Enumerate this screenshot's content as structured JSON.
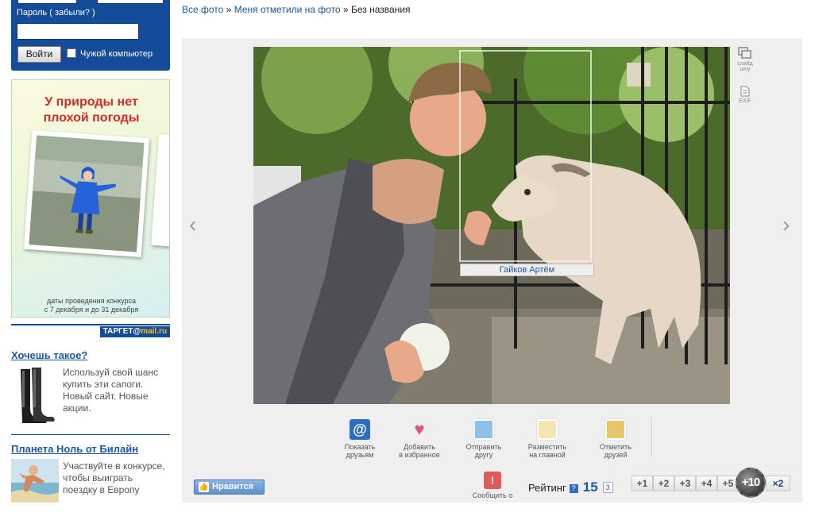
{
  "login": {
    "password_label": "Пароль",
    "forgot_link": "( забыли? )",
    "submit_label": "Войти",
    "foreign_computer_label": "Чужой компьютер"
  },
  "ad_banner": {
    "headline": "У природы нет плохой погоды",
    "dates_line1": "даты проведения конкурса",
    "dates_line2": "с 7 декабря и до 31 декабря",
    "source_label_prefix": "ТАРГЕТ@",
    "source_label_brand": "mail.ru"
  },
  "promos": [
    {
      "title": "Хочешь такое?",
      "text": "Используй свой шанс купить эти сапоги. Новый сайт. Новые акции.",
      "icon": "boots-image"
    },
    {
      "title": "Планета Ноль от Билайн",
      "text": "Участвуйте в конкурсе, чтобы выиграть поездку в Европу",
      "icon": "beach-image"
    }
  ],
  "breadcrumbs": {
    "all_photos": "Все фото",
    "tagged_photos": "Меня отметили на фото",
    "separator": "»",
    "current": "Без названия"
  },
  "viewer": {
    "tag_name": "Гайков Артём",
    "prev_arrow": "‹",
    "next_arrow": "›",
    "slideshow_label": "слайд шоу",
    "exif_label": "EXIF"
  },
  "actions": [
    {
      "label1": "Показать",
      "label2": "друзьям",
      "icon": "at-sign-icon",
      "color": "#2a6fbf"
    },
    {
      "label1": "Добавить",
      "label2": "в избранное",
      "icon": "heart-plus-icon",
      "color": "#e0527c"
    },
    {
      "label1": "Отправить",
      "label2": "другу",
      "icon": "send-photo-icon",
      "color": "#6aa0d8"
    },
    {
      "label1": "Разместить",
      "label2": "на главной",
      "icon": "place-on-main-icon",
      "color": "#d8b040"
    },
    {
      "label1": "Отметить",
      "label2": "друзей",
      "icon": "tag-friends-icon",
      "color": "#d8a040"
    }
  ],
  "like_label": "Нравится",
  "report_label": "Сообщить о нарушении",
  "rating": {
    "label": "Рейтинг",
    "help": "?",
    "value": "15",
    "comments_count": "3",
    "buttons": [
      "+1",
      "+2",
      "+3",
      "+4",
      "+5"
    ],
    "plus10": "+10",
    "x2": "×2"
  }
}
